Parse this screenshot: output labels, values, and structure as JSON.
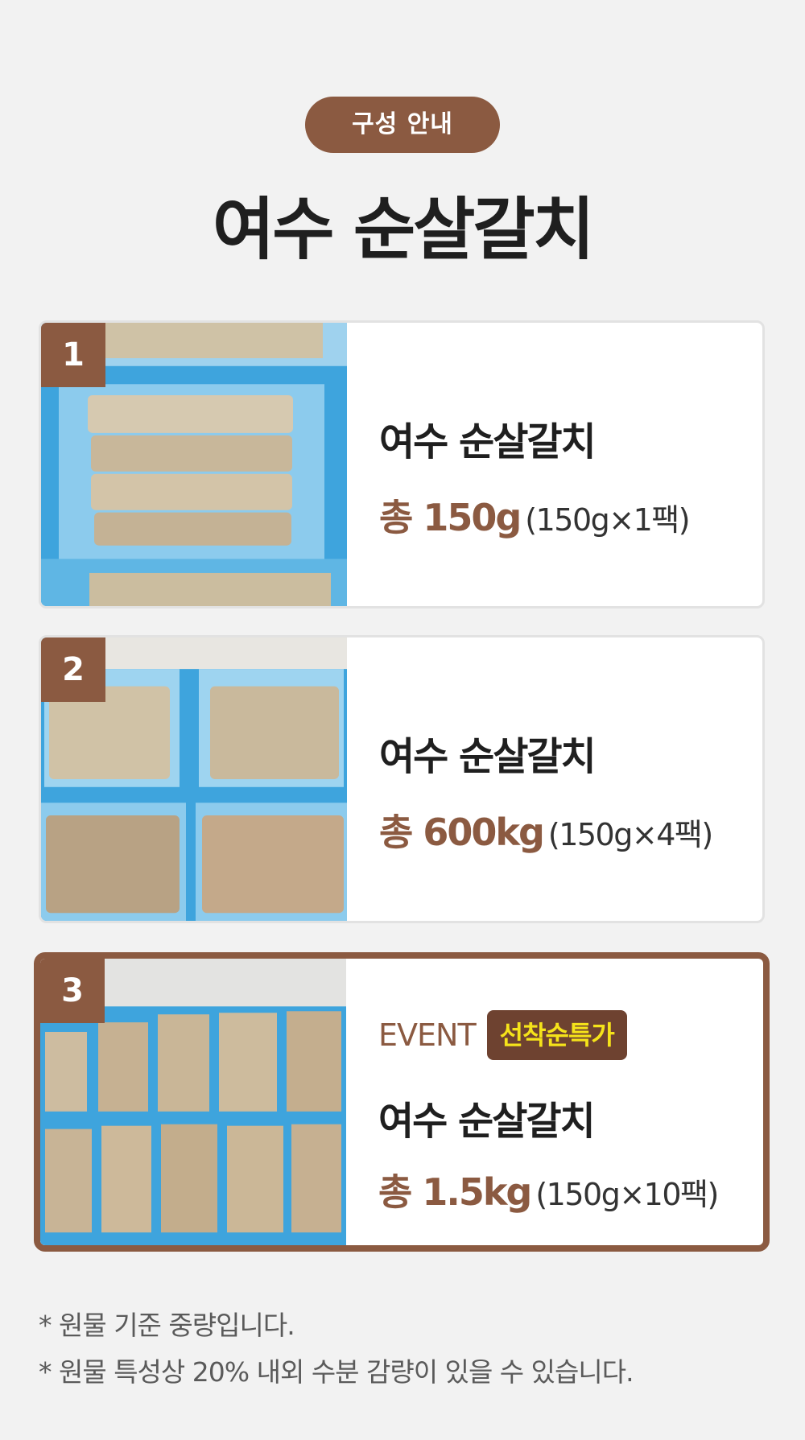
{
  "header": {
    "badge": "구성 안내",
    "title": "여수 순살갈치"
  },
  "options": [
    {
      "number": "1",
      "name": "여수 순살갈치",
      "total": "총 150g",
      "detail": "(150g×1팩)"
    },
    {
      "number": "2",
      "name": "여수 순살갈치",
      "total": "총 600kg",
      "detail": "(150g×4팩)"
    },
    {
      "number": "3",
      "event_label": "EVENT",
      "event_badge": "선착순특가",
      "name": "여수 순살갈치",
      "total": "총 1.5kg",
      "detail": "(150g×10팩)"
    }
  ],
  "notes": [
    "* 원물 기준 중량입니다.",
    "* 원물 특성상 20% 내외 수분 감량이 있을 수 있습니다."
  ],
  "colors": {
    "accent": "#8b5a41",
    "event_badge_bg": "#6e4230",
    "event_badge_text": "#f5e31a",
    "background": "#f2f2f2"
  }
}
